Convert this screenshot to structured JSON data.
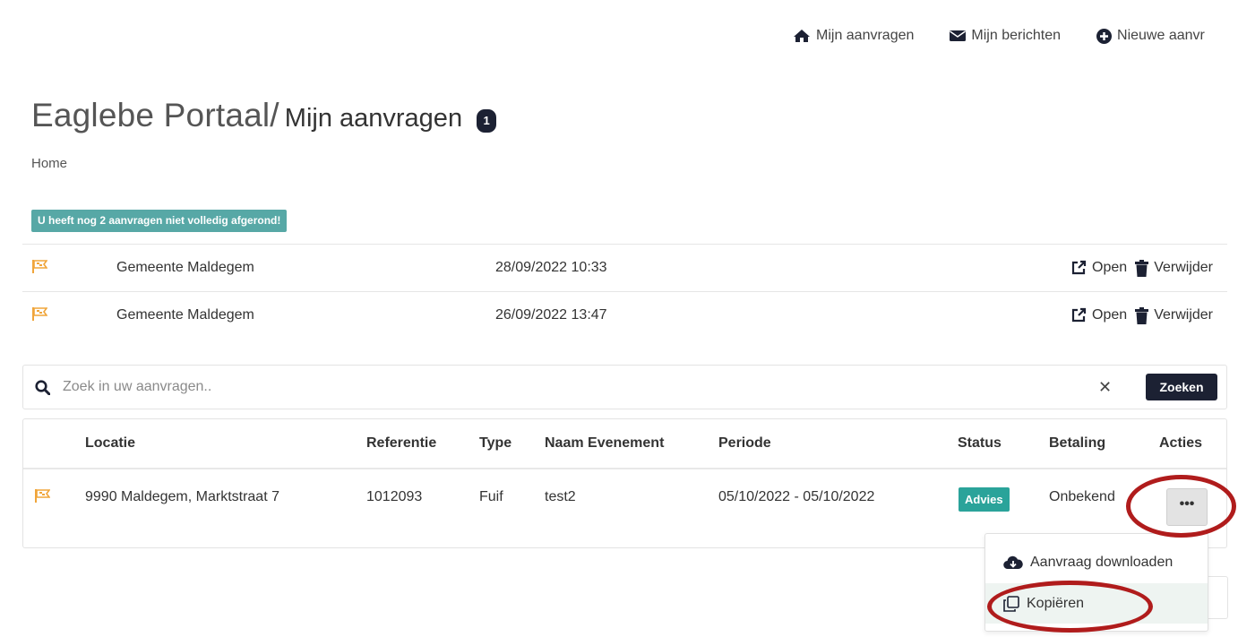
{
  "topnav": {
    "items": [
      {
        "label": "Mijn aanvragen",
        "icon": "home-icon"
      },
      {
        "label": "Mijn berichten",
        "icon": "envelope-icon"
      },
      {
        "label": "Nieuwe aanvr",
        "icon": "plus-circle-icon"
      }
    ]
  },
  "header": {
    "brand": "Eaglebe Portaal/",
    "subtitle": "Mijn aanvragen",
    "count": "1"
  },
  "breadcrumb": "Home",
  "alert": "U heeft nog 2 aanvragen niet volledig afgerond!",
  "drafts": [
    {
      "location": "Gemeente Maldegem",
      "date": "28/09/2022 10:33",
      "open_label": "Open",
      "delete_label": "Verwijder"
    },
    {
      "location": "Gemeente Maldegem",
      "date": "26/09/2022 13:47",
      "open_label": "Open",
      "delete_label": "Verwijder"
    }
  ],
  "search": {
    "placeholder": "Zoek in uw aanvragen..",
    "value": "",
    "clear_label": "✕",
    "button_label": "Zoeken"
  },
  "table": {
    "headers": [
      "Locatie",
      "Referentie",
      "Type",
      "Naam Evenement",
      "Periode",
      "Status",
      "Betaling",
      "Acties"
    ],
    "rows": [
      {
        "locatie": "9990 Maldegem, Marktstraat 7",
        "referentie": "1012093",
        "type": "Fuif",
        "naam": "test2",
        "periode": "05/10/2022 - 05/10/2022",
        "status": "Advies",
        "betaling": "Onbekend",
        "actions_label": "•••"
      }
    ]
  },
  "dropdown": {
    "items": [
      {
        "label": "Aanvraag downloaden",
        "icon": "cloud-download-icon"
      },
      {
        "label": "Kopiëren",
        "icon": "copy-icon"
      }
    ]
  },
  "colors": {
    "primary_dark": "#1c2133",
    "alert_teal": "#57a8a6",
    "status_teal": "#2aa39a",
    "flag_orange": "#f0a53a",
    "annotation_red": "#b01c1c"
  }
}
